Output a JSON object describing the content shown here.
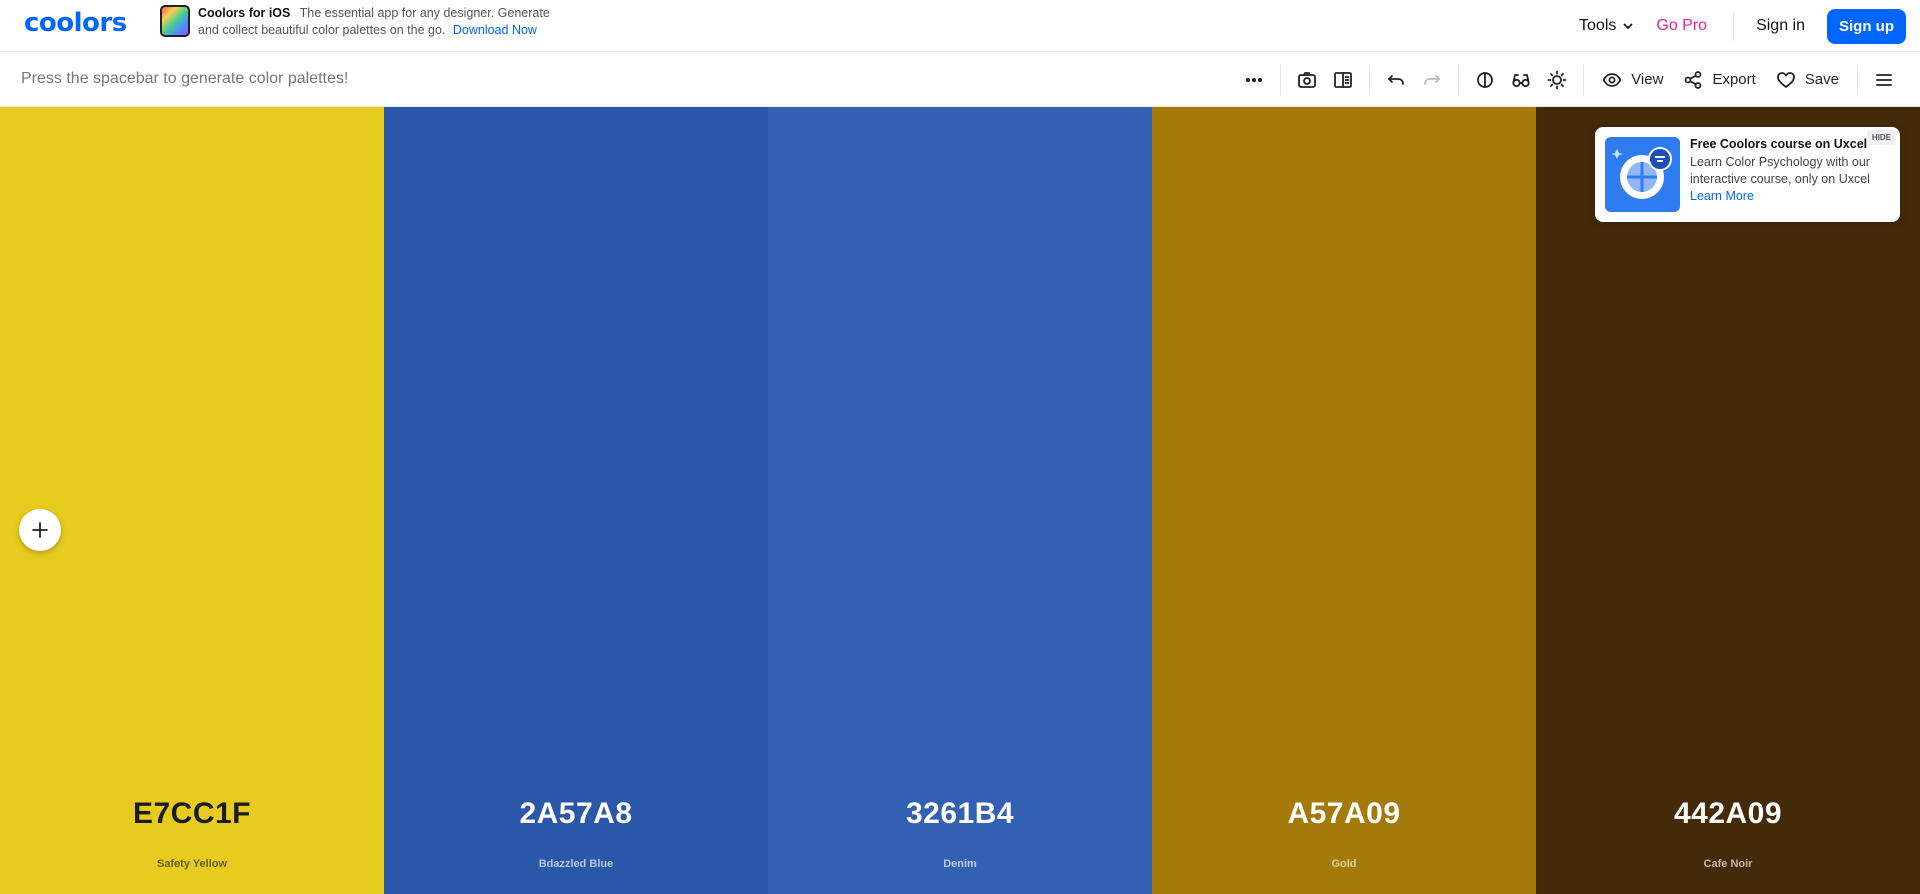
{
  "brand": {
    "logo": "coolors"
  },
  "promo": {
    "title": "Coolors for iOS",
    "body": "The essential app for any designer. Generate and collect beautiful color palettes on the go.",
    "link": "Download Now"
  },
  "nav": {
    "tools": "Tools",
    "gopro": "Go Pro",
    "signin": "Sign in",
    "signup": "Sign up"
  },
  "toolbar": {
    "hint": "Press the spacebar to generate color palettes!",
    "view": "View",
    "export": "Export",
    "save": "Save"
  },
  "palette": [
    {
      "hex": "E7CC1F",
      "name": "Safety Yellow",
      "color": "#E7CC1F",
      "text": "#1b1b1b",
      "sub": "#6b5d12"
    },
    {
      "hex": "2A57A8",
      "name": "Bdazzled Blue",
      "color": "#2A57A8",
      "text": "#ffffff",
      "sub": "#b7c6e3"
    },
    {
      "hex": "3261B4",
      "name": "Denim",
      "color": "#3261B4",
      "text": "#ffffff",
      "sub": "#bcc9e6"
    },
    {
      "hex": "A57A09",
      "name": "Gold",
      "color": "#A57A09",
      "text": "#ffffff",
      "sub": "#e1cfa3"
    },
    {
      "hex": "442A09",
      "name": "Cafe Noir",
      "color": "#442A09",
      "text": "#ffffff",
      "sub": "#c5b8a8"
    }
  ],
  "ad": {
    "hide": "HIDE",
    "title": "Free Coolors course on Uxcel",
    "body": "Learn Color Psychology with our interactive course, only on Uxcel",
    "link": "Learn More"
  }
}
